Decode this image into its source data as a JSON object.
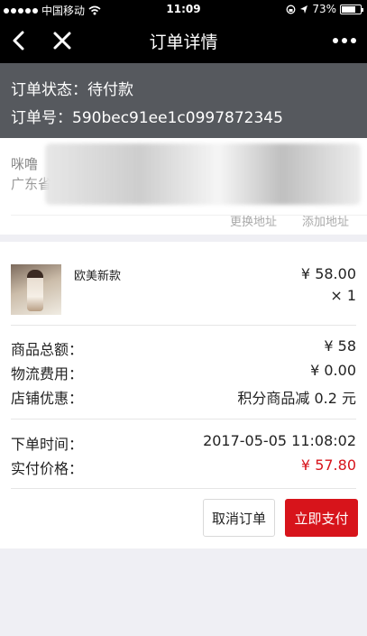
{
  "status_bar": {
    "carrier": "中国移动",
    "time": "11:09",
    "battery": "73%",
    "battery_level": 0.73
  },
  "nav": {
    "title": "订单详情"
  },
  "order_status": {
    "status_line": "订单状态：待付款",
    "order_no_line": "订单号：590bec91ee1c0997872345"
  },
  "address": {
    "name_fragment": "咪噜",
    "detail_fragment": "广东省",
    "change_label": "更换地址",
    "add_label": "添加地址"
  },
  "product": {
    "name": "欧美新款",
    "price": "¥ 58.00",
    "quantity": "× 1"
  },
  "summary": {
    "total_label": "商品总额：",
    "total_value": "¥ 58",
    "shipping_label": "物流费用：",
    "shipping_value": "¥ 0.00",
    "discount_label": "店铺优惠：",
    "discount_value": "积分商品减 0.2 元"
  },
  "order_info": {
    "time_label": "下单时间：",
    "time_value": "2017-05-05 11:08:02",
    "paid_label": "实付价格：",
    "paid_value": "¥ 57.80"
  },
  "actions": {
    "cancel_label": "取消订单",
    "pay_label": "立即支付"
  },
  "colors": {
    "accent": "#d7141b",
    "status_band": "#56595e",
    "nav_bg": "#000000"
  }
}
